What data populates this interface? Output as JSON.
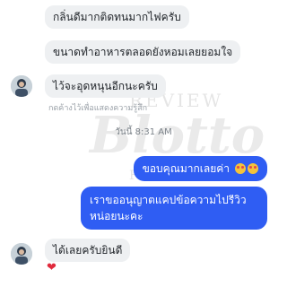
{
  "messages": {
    "incoming_1": "กลิ่นดีมากติดทนมากไฟครับ",
    "incoming_2": "ขนาดทำอาหารตลอดยังหอมเลยยอมใจ",
    "incoming_3": "ไว้จะอุดหนุนอีกนะครับ",
    "hint": "กดค้างไว้เพื่อแสดงความรู้สึก",
    "timestamp": "วันนี้ 8:31 AM",
    "outgoing_1": "ขอบคุณมากเลยค่า",
    "outgoing_2": "เราขออนุญาตแคปข้อความไปรีวิวหน่อยนะคะ",
    "incoming_4": "ได้เลยครับยินดี",
    "reaction": "❤"
  },
  "watermark": {
    "top": "REVIEW",
    "main": "Blotto",
    "bottom": "FRAGRANCE"
  },
  "icons": {
    "avatar": "avatar",
    "emoji": "heart-eyes-emoji",
    "reaction": "heart-icon"
  },
  "colors": {
    "incoming_bubble": "#eef0f2",
    "outgoing_bubble": "#2f5df3",
    "heart": "#e02a3c"
  }
}
